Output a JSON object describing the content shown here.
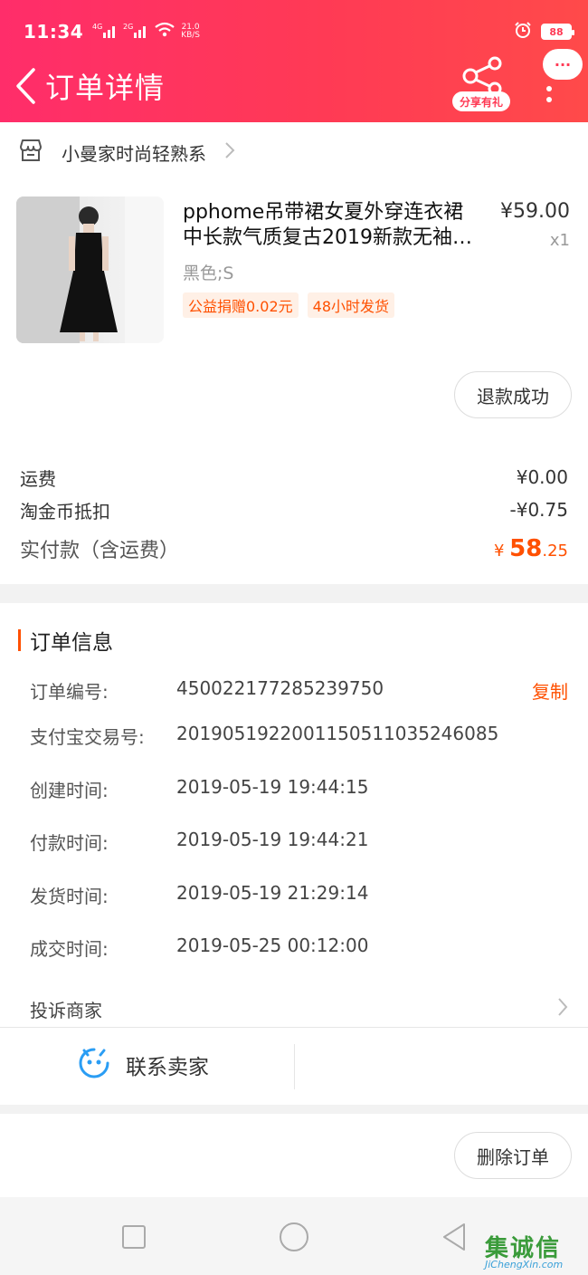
{
  "status_bar": {
    "time": "11:34",
    "net_a": "4G",
    "net_b": "2G",
    "speed_value": "21.0",
    "speed_unit": "KB/S",
    "battery": "88"
  },
  "header": {
    "title": "订单详情",
    "share_label": "分享有礼",
    "message_label": "···",
    "colors": {
      "gradient_start": "#ff2d6a",
      "gradient_end": "#ff4a4a"
    }
  },
  "shop": {
    "name": "小曼家时尚轻熟系"
  },
  "product": {
    "title": "pphome吊带裙女夏外穿连衣裙中长款气质复古2019新款无袖…",
    "price": "¥59.00",
    "quantity": "x1",
    "sku": "黑色;S",
    "tags": [
      "公益捐赠0.02元",
      "48小时发货"
    ],
    "refund_status": "退款成功"
  },
  "fees": {
    "shipping_label": "运费",
    "shipping_value": "¥0.00",
    "coin_label": "淘金币抵扣",
    "coin_value": "-¥0.75",
    "total_label": "实付款（含运费）",
    "total_currency": "¥",
    "total_integer": "58",
    "total_decimal": ".25",
    "accent_color": "#ff5000"
  },
  "order_info": {
    "title": "订单信息",
    "copy_label": "复制",
    "rows": [
      {
        "label": "订单编号:",
        "value": "450022177285239750"
      },
      {
        "label": "支付宝交易号:",
        "value": "2019051922001150511035246085"
      },
      {
        "label": "创建时间:",
        "value": "2019-05-19 19:44:15"
      },
      {
        "label": "付款时间:",
        "value": "2019-05-19 19:44:21"
      },
      {
        "label": "发货时间:",
        "value": "2019-05-19 21:29:14"
      },
      {
        "label": "成交时间:",
        "value": "2019-05-25 00:12:00"
      }
    ],
    "complain_label": "投诉商家"
  },
  "contact": {
    "label": "联系卖家"
  },
  "actions": {
    "delete_label": "删除订单"
  },
  "watermark": {
    "text": "集诚信",
    "sub": "JiChengXin.com"
  }
}
